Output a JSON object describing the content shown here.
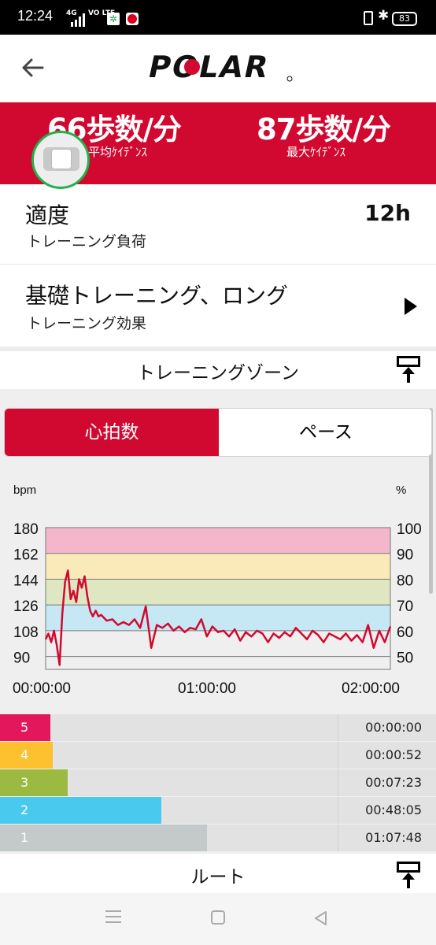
{
  "status_bar": {
    "time": "12:24",
    "network": "4G",
    "volte": "VO LTE",
    "battery": "83"
  },
  "header": {
    "logo_text": "POLAR"
  },
  "stats": {
    "avg_cadence": {
      "value": "66歩数/分",
      "label": "平均ｹｲﾃﾞﾝｽ"
    },
    "max_cadence": {
      "value": "87歩数/分",
      "label": "最大ｹｲﾃﾞﾝｽ"
    }
  },
  "training_load": {
    "title": "適度",
    "subtitle": "トレーニング負荷",
    "value": "12h"
  },
  "training_benefit": {
    "title": "基礎トレーニング、ロング",
    "subtitle": "トレーニング効果"
  },
  "training_zones": {
    "title": "トレーニングゾーン"
  },
  "tabs": {
    "heart_rate": "心拍数",
    "pace": "ペース"
  },
  "chart_data": {
    "type": "line",
    "left_unit": "bpm",
    "right_unit": "%",
    "y_ticks_left": [
      180,
      162,
      144,
      126,
      108,
      90
    ],
    "y_ticks_right": [
      100,
      90,
      80,
      70,
      60,
      50
    ],
    "x_ticks": [
      "00:00:00",
      "01:00:00",
      "02:00:00"
    ],
    "ylim": [
      81,
      180
    ],
    "xlim_minutes": [
      0,
      124
    ],
    "zone_bands": [
      {
        "from": 162,
        "to": 180,
        "color": "#f3b6cb"
      },
      {
        "from": 144,
        "to": 162,
        "color": "#fbeab9"
      },
      {
        "from": 126,
        "to": 144,
        "color": "#dfe7c2"
      },
      {
        "from": 108,
        "to": 126,
        "color": "#c6e8f4"
      },
      {
        "from": 81,
        "to": 108,
        "color": "#efefef"
      }
    ],
    "line_color": "#d10930",
    "series": [
      {
        "x": [
          0,
          1,
          2,
          3,
          4,
          5,
          6,
          7,
          8,
          9,
          10,
          11,
          12,
          13,
          14,
          15,
          16,
          17,
          18,
          19,
          20,
          22,
          24,
          26,
          28,
          30,
          32,
          34,
          36,
          38,
          40,
          42,
          44,
          46,
          48,
          50,
          52,
          54,
          56,
          58,
          60,
          62,
          64,
          66,
          68,
          70,
          72,
          74,
          76,
          78,
          80,
          82,
          84,
          86,
          88,
          90,
          92,
          94,
          96,
          98,
          100,
          102,
          104,
          106,
          108,
          110,
          112,
          114,
          116,
          118,
          120,
          122,
          124
        ],
        "y": [
          102,
          106,
          100,
          108,
          98,
          84,
          120,
          142,
          150,
          130,
          136,
          128,
          144,
          138,
          146,
          132,
          122,
          118,
          122,
          118,
          119,
          115,
          116,
          112,
          114,
          112,
          116,
          110,
          125,
          96,
          112,
          110,
          113,
          108,
          111,
          107,
          110,
          109,
          116,
          104,
          111,
          107,
          108,
          104,
          109,
          101,
          107,
          104,
          108,
          106,
          100,
          106,
          103,
          107,
          104,
          110,
          106,
          102,
          108,
          105,
          100,
          106,
          104,
          102,
          106,
          101,
          105,
          100,
          112,
          96,
          108,
          100,
          111
        ]
      }
    ]
  },
  "zones": [
    {
      "num": "5",
      "color": "#e2175c",
      "fraction": 0.0,
      "time": "00:00:00"
    },
    {
      "num": "4",
      "color": "#fdc02e",
      "fraction": 0.007,
      "time": "00:00:52"
    },
    {
      "num": "3",
      "color": "#9cba42",
      "fraction": 0.06,
      "time": "00:07:23"
    },
    {
      "num": "2",
      "color": "#4ac9ef",
      "fraction": 0.387,
      "time": "00:48:05"
    },
    {
      "num": "1",
      "color": "#c4c9ca",
      "fraction": 0.546,
      "time": "01:07:48"
    }
  ],
  "route": {
    "title": "ルート"
  }
}
